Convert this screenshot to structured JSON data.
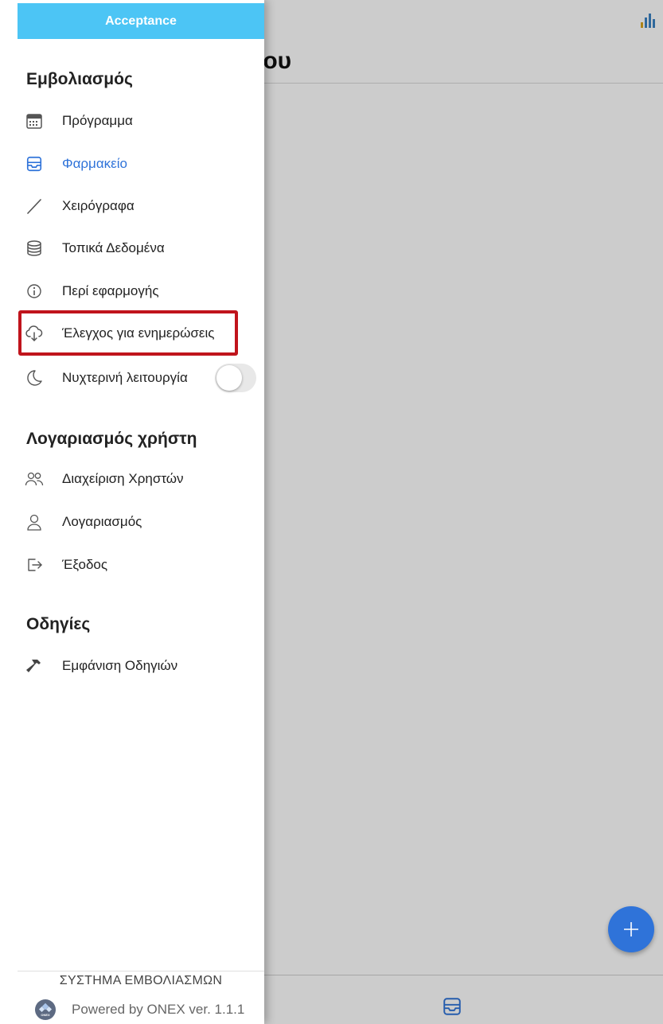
{
  "background": {
    "title_fragment": "ίου",
    "chart_icon": "bar-chart-icon",
    "bottom_icon": "pharmacy-inbox-icon",
    "fab_icon": "plus-icon"
  },
  "drawer": {
    "environment_label": "Acceptance",
    "sections": {
      "vaccination": {
        "title": "Εμβολιασμός",
        "items": {
          "schedule": {
            "label": "Πρόγραμμα",
            "icon": "calendar-icon"
          },
          "pharmacy": {
            "label": "Φαρμακείο",
            "icon": "inbox-icon",
            "active": true
          },
          "drafts": {
            "label": "Χειρόγραφα",
            "icon": "pencil-icon"
          },
          "local_data": {
            "label": "Τοπικά Δεδομένα",
            "icon": "database-icon"
          },
          "about": {
            "label": "Περί εφαρμογής",
            "icon": "info-icon"
          },
          "check_updates": {
            "label": "Έλεγχος για ενημερώσεις",
            "icon": "cloud-download-icon"
          },
          "night_mode": {
            "label": "Νυχτερινή λειτουργία",
            "icon": "moon-icon",
            "enabled": false
          }
        }
      },
      "account": {
        "title": "Λογαριασμός χρήστη",
        "items": {
          "user_management": {
            "label": "Διαχείριση Χρηστών",
            "icon": "users-icon"
          },
          "account": {
            "label": "Λογαριασμός",
            "icon": "user-icon"
          },
          "logout": {
            "label": "Έξοδος",
            "icon": "logout-icon"
          }
        }
      },
      "guides": {
        "title": "Οδηγίες",
        "items": {
          "show_guides": {
            "label": "Εμφάνιση Οδηγιών",
            "icon": "hammer-icon"
          }
        }
      }
    },
    "footer": {
      "system_name": "ΣΥΣΤΗΜΑ ΕΜΒΟΛΙΑΣΜΩΝ",
      "powered_by": "Powered by ONEX ver. 1.1.1",
      "logo_text": "ONEX"
    }
  },
  "colors": {
    "accent": "#2f73d9",
    "banner": "#4cc5f5",
    "highlight": "#c0141c"
  }
}
